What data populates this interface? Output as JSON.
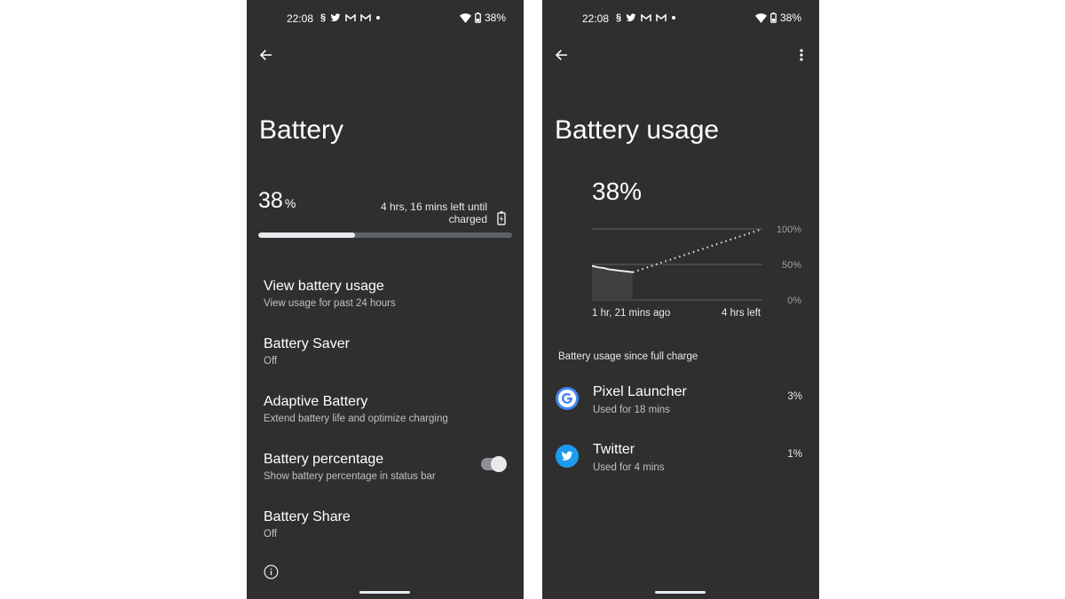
{
  "status_bar": {
    "time": "22:08",
    "battery_pct": "38%"
  },
  "left_screen": {
    "title": "Battery",
    "level_value": "38",
    "level_unit": "%",
    "level_fraction": 0.38,
    "time_left": "4 hrs, 16 mins left until charged",
    "prefs": [
      {
        "title": "View battery usage",
        "summary": "View usage for past 24 hours"
      },
      {
        "title": "Battery Saver",
        "summary": "Off"
      },
      {
        "title": "Adaptive Battery",
        "summary": "Extend battery life and optimize charging"
      },
      {
        "title": "Battery percentage",
        "summary": "Show battery percentage in status bar",
        "toggle_on": true
      },
      {
        "title": "Battery Share",
        "summary": "Off"
      }
    ]
  },
  "right_screen": {
    "title": "Battery usage",
    "level": "38%",
    "chart_data": {
      "type": "line",
      "y_tick_labels": [
        "100%",
        "50%",
        "0%"
      ],
      "ylim": [
        0,
        100
      ],
      "x_start_label": "1 hr, 21 mins ago",
      "x_end_label": "4 hrs left",
      "series": [
        {
          "values": [
            48,
            46,
            45,
            43,
            42,
            41,
            40,
            39
          ]
        },
        {
          "values": [
            39,
            100
          ]
        }
      ]
    },
    "section_header": "Battery usage since full charge",
    "apps": [
      {
        "name": "Pixel Launcher",
        "usage": "Used for 18 mins",
        "percent": "3%",
        "icon": "google-g-icon"
      },
      {
        "name": "Twitter",
        "usage": "Used for 4 mins",
        "percent": "1%",
        "icon": "twitter-bird-icon"
      }
    ]
  },
  "colors": {
    "background": "#2f2f2f",
    "text": "#ffffff",
    "accent_google": "#4285f4",
    "accent_twitter": "#1d9bf0"
  }
}
